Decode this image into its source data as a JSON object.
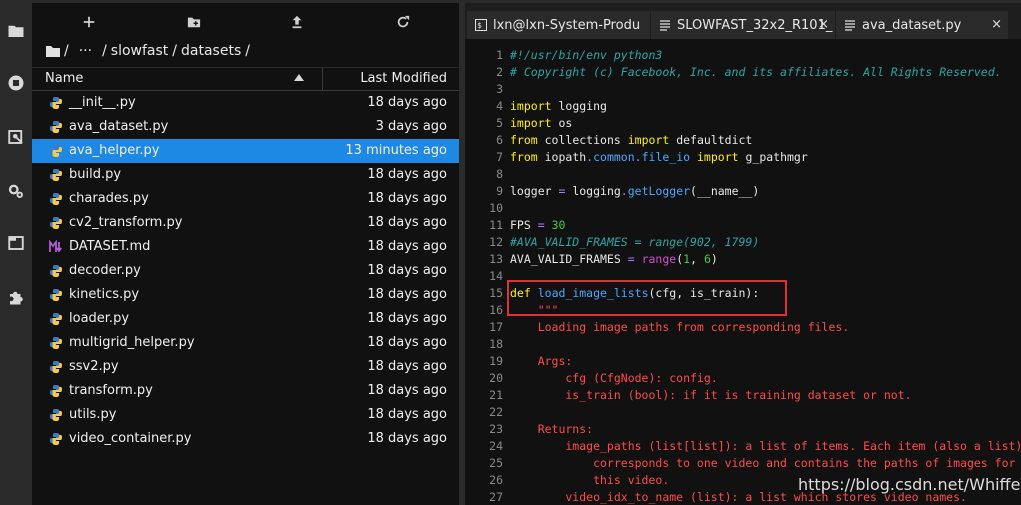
{
  "file_browser": {
    "breadcrumb": {
      "ellipsis": "···",
      "parts": [
        "slowfast",
        "datasets"
      ],
      "separator": "/"
    },
    "columns": {
      "name": "Name",
      "modified": "Last Modified"
    },
    "files": [
      {
        "name": "__init__.py",
        "modified": "18 days ago",
        "icon": "python-icon"
      },
      {
        "name": "ava_dataset.py",
        "modified": "3 days ago",
        "icon": "python-icon"
      },
      {
        "name": "ava_helper.py",
        "modified": "13 minutes ago",
        "icon": "python-icon"
      },
      {
        "name": "build.py",
        "modified": "18 days ago",
        "icon": "python-icon"
      },
      {
        "name": "charades.py",
        "modified": "18 days ago",
        "icon": "python-icon"
      },
      {
        "name": "cv2_transform.py",
        "modified": "18 days ago",
        "icon": "python-icon"
      },
      {
        "name": "DATASET.md",
        "modified": "18 days ago",
        "icon": "markdown-icon"
      },
      {
        "name": "decoder.py",
        "modified": "18 days ago",
        "icon": "python-icon"
      },
      {
        "name": "kinetics.py",
        "modified": "18 days ago",
        "icon": "python-icon"
      },
      {
        "name": "loader.py",
        "modified": "18 days ago",
        "icon": "python-icon"
      },
      {
        "name": "multigrid_helper.py",
        "modified": "18 days ago",
        "icon": "python-icon"
      },
      {
        "name": "ssv2.py",
        "modified": "18 days ago",
        "icon": "python-icon"
      },
      {
        "name": "transform.py",
        "modified": "18 days ago",
        "icon": "python-icon"
      },
      {
        "name": "utils.py",
        "modified": "18 days ago",
        "icon": "python-icon"
      },
      {
        "name": "video_container.py",
        "modified": "18 days ago",
        "icon": "python-icon"
      }
    ],
    "selected_file": "ava_helper.py"
  },
  "tabs": [
    {
      "label": "lxn@lxn-System-Produ",
      "icon": "terminal-icon"
    },
    {
      "label": "SLOWFAST_32x2_R101_",
      "icon": "file-text-icon"
    },
    {
      "label": "ava_dataset.py",
      "icon": "file-text-icon"
    }
  ],
  "tab_close": "×",
  "editor": {
    "lines": [
      [
        {
          "t": "#!/usr/bin/env python3",
          "c": "cmt"
        }
      ],
      [
        {
          "t": "# Copyright (c) Facebook, Inc. and its affiliates. All Rights Reserved.",
          "c": "cmt"
        }
      ],
      [],
      [
        {
          "t": "import",
          "c": "kw"
        },
        {
          "t": " logging"
        }
      ],
      [
        {
          "t": "import",
          "c": "kw"
        },
        {
          "t": " os"
        }
      ],
      [
        {
          "t": "from",
          "c": "kw"
        },
        {
          "t": " collections "
        },
        {
          "t": "import",
          "c": "kw"
        },
        {
          "t": " defaultdict"
        }
      ],
      [
        {
          "t": "from",
          "c": "kw"
        },
        {
          "t": " iopath"
        },
        {
          "t": ".",
          "c": "op"
        },
        {
          "t": "common",
          "c": "fn"
        },
        {
          "t": ".",
          "c": "op"
        },
        {
          "t": "file_io",
          "c": "fn"
        },
        {
          "t": " "
        },
        {
          "t": "import",
          "c": "kw"
        },
        {
          "t": " g_pathmgr"
        }
      ],
      [],
      [
        {
          "t": "logger "
        },
        {
          "t": "=",
          "c": "op"
        },
        {
          "t": " logging"
        },
        {
          "t": ".",
          "c": "op"
        },
        {
          "t": "getLogger",
          "c": "fn"
        },
        {
          "t": "(__name__)"
        }
      ],
      [],
      [
        {
          "t": "FPS "
        },
        {
          "t": "=",
          "c": "op"
        },
        {
          "t": " "
        },
        {
          "t": "30",
          "c": "num"
        }
      ],
      [
        {
          "t": "#AVA_VALID_FRAMES = range(902, 1799)",
          "c": "cmt"
        }
      ],
      [
        {
          "t": "AVA_VALID_FRAMES "
        },
        {
          "t": "=",
          "c": "op"
        },
        {
          "t": " "
        },
        {
          "t": "range",
          "c": "mag"
        },
        {
          "t": "("
        },
        {
          "t": "1",
          "c": "num"
        },
        {
          "t": ", "
        },
        {
          "t": "6",
          "c": "num"
        },
        {
          "t": ")"
        }
      ],
      [],
      [
        {
          "t": "def",
          "c": "kw"
        },
        {
          "t": " "
        },
        {
          "t": "load_image_lists",
          "c": "fn"
        },
        {
          "t": "(cfg, is_train):"
        }
      ],
      [
        {
          "t": "    "
        },
        {
          "t": "\"\"\"",
          "c": "str"
        }
      ],
      [
        {
          "t": "    Loading image paths from corresponding files.",
          "c": "str"
        }
      ],
      [],
      [
        {
          "t": "    Args:",
          "c": "str"
        }
      ],
      [
        {
          "t": "        cfg (CfgNode): config.",
          "c": "str"
        }
      ],
      [
        {
          "t": "        is_train (bool): if it is training dataset or not.",
          "c": "str"
        }
      ],
      [],
      [
        {
          "t": "    Returns:",
          "c": "str"
        }
      ],
      [
        {
          "t": "        image_paths (list[list]): a list of items. Each item (also a list)",
          "c": "str"
        }
      ],
      [
        {
          "t": "            corresponds to one video and contains the paths of images for",
          "c": "str"
        }
      ],
      [
        {
          "t": "            this video.",
          "c": "str"
        }
      ],
      [
        {
          "t": "        video_idx_to_name (list): a list which stores video names.",
          "c": "str"
        }
      ]
    ]
  },
  "watermark": "https://blog.csdn.net/WhiffeYF",
  "colors": {
    "selected_row": "#1e88e5",
    "highlight_box": "#e03030",
    "keyword": "#fff200",
    "comment": "#2ba5a5",
    "string": "#ff4a4a"
  }
}
